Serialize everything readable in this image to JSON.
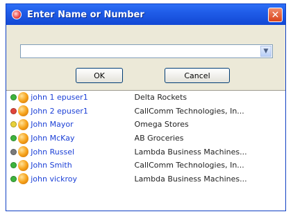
{
  "dialog": {
    "title": "Enter Name or Number",
    "close_glyph": "✕",
    "combo_value": "",
    "combo_arrow": "▼",
    "ok_label": "OK",
    "cancel_label": "Cancel"
  },
  "contacts": [
    {
      "name": "john 1 epuser1",
      "company": "Delta Rockets",
      "status_color": "#3db43d"
    },
    {
      "name": "John 2 epuser1",
      "company": "CallComm Technologies, In...",
      "status_color": "#e0443a"
    },
    {
      "name": "John Mayor",
      "company": "Omega Stores",
      "status_color": "#e7d13b"
    },
    {
      "name": "John McKay",
      "company": "AB Groceries",
      "status_color": "#3db43d"
    },
    {
      "name": "John Russel",
      "company": "Lambda Business Machines...",
      "status_color": "#7a7a7a"
    },
    {
      "name": "John Smith",
      "company": "CallComm Technologies, In...",
      "status_color": "#3db43d"
    },
    {
      "name": "john vickroy",
      "company": "Lambda Business Machines...",
      "status_color": "#3db43d"
    }
  ]
}
